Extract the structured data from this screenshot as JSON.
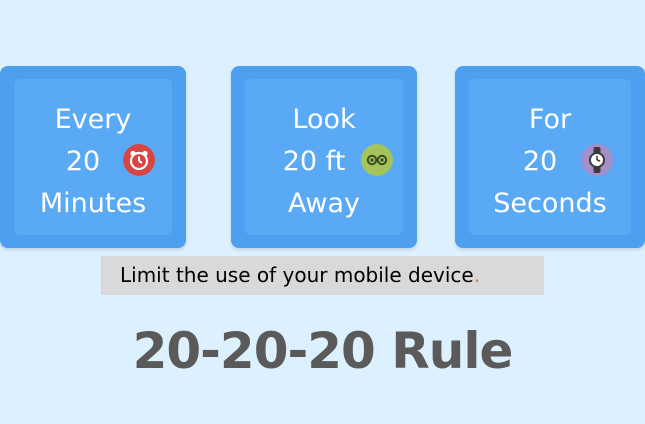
{
  "cards": [
    {
      "line1": "Every",
      "line2": "20",
      "line3": "Minutes",
      "icon": "alarm-clock-icon",
      "icon_color": "#d94543"
    },
    {
      "line1": "Look",
      "line2": "20 ft",
      "line3": "Away",
      "icon": "eyes-icon",
      "icon_color": "#a4c45a"
    },
    {
      "line1": "For",
      "line2": "20",
      "line3": "Seconds",
      "icon": "wristwatch-icon",
      "icon_color": "#a38fc9"
    }
  ],
  "caption": {
    "text": "Limit the use of your mobile device",
    "punctuation": "."
  },
  "title": "20-20-20 Rule",
  "colors": {
    "background": "#dcf1fd",
    "card": "#4f9ff0",
    "caption_bg": "#d9d9d9",
    "title": "#5a5a5a",
    "accent": "#ed7d31"
  }
}
